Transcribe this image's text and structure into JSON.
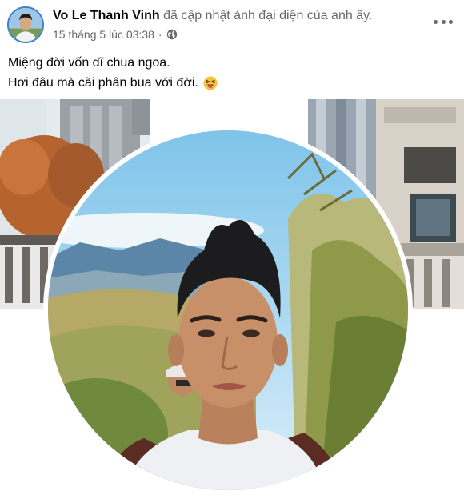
{
  "post": {
    "author": "Vo Le Thanh Vinh",
    "action": "đã cập nhật ảnh đại diện của anh ấy.",
    "timestamp": "15 tháng 5 lúc 03:38",
    "separator": "·",
    "privacy_icon": "globe-icon",
    "more_icon": "more-options-icon",
    "caption_lines": [
      "Miệng đời vốn dĩ chua ngoa.",
      "Hơi đâu mà cãi phân bua với đời."
    ],
    "caption_emoji": "squinting-tongue-emoji"
  },
  "colors": {
    "name": "#050505",
    "secondary": "#65676b",
    "avatar_ring": "#3b82c4"
  }
}
